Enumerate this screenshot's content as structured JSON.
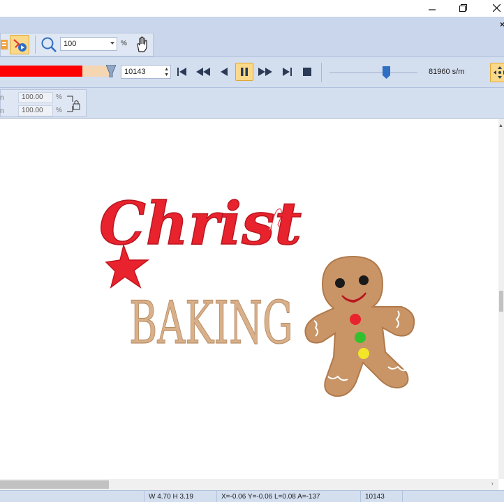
{
  "window": {
    "minimize_icon": "minimize-icon",
    "restore_icon": "restore-icon",
    "close_label": "×"
  },
  "toolbar": {
    "zoom_value": "100",
    "zoom_unit": "%",
    "icons": [
      "stitch-player-icon",
      "zoom-icon",
      "pan-hand-icon"
    ]
  },
  "player": {
    "progress_fraction": 0.74,
    "stitch_number": "10143",
    "speed_label": "81960 s/m",
    "speed_fraction": 0.64,
    "controls": [
      "first-icon",
      "rewind-icon",
      "step-back-icon",
      "pause-icon",
      "fast-forward-icon",
      "last-icon",
      "stop-icon"
    ],
    "progress_color": "#ff0000",
    "remaining_color": "#f5d6b3"
  },
  "scale": {
    "width_label": "n",
    "width_value": "100.00",
    "height_label": "n",
    "height_value": "100.00",
    "unit": "%"
  },
  "design": {
    "word1": "Christ",
    "word2": "BAKING",
    "accent_red": "#e8232e",
    "tan": "#d8b08a",
    "cookie": "#c99466"
  },
  "status": {
    "size": "W 4.70 H 3.19",
    "coords": "X=-0.06 Y=-0.06 L=0.08 A=-137",
    "stitch": "10143"
  }
}
